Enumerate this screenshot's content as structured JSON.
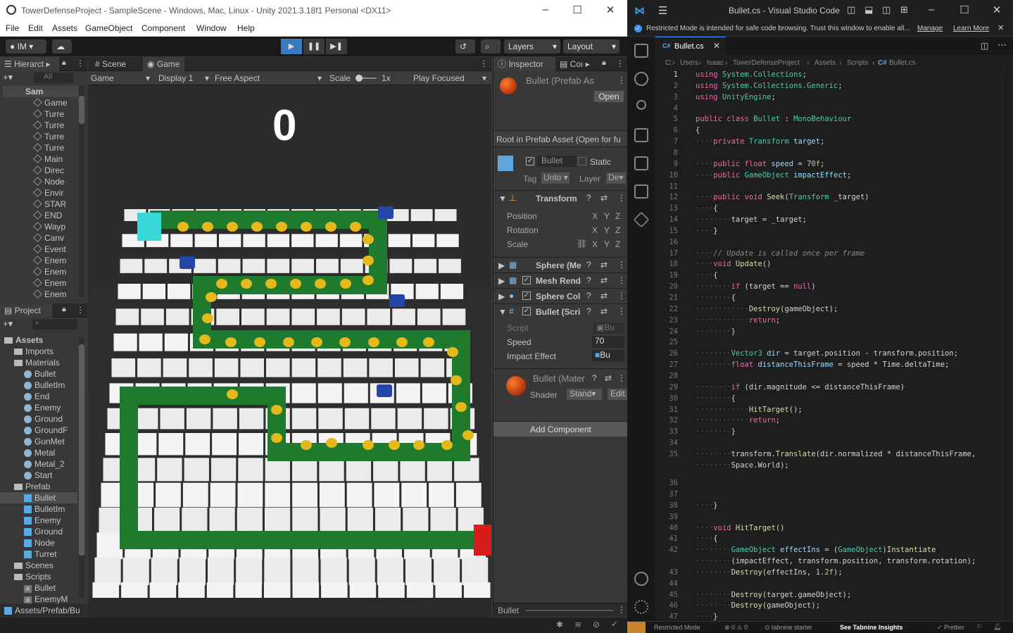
{
  "unity": {
    "title": "TowerDefenseProject - SampleScene - Windows, Mac, Linux - Unity 2021.3.18f1 Personal <DX11>",
    "menu": [
      "File",
      "Edit",
      "Assets",
      "GameObject",
      "Component",
      "Window",
      "Help"
    ],
    "toolbar": {
      "account": "IM",
      "layers": "Layers",
      "layout": "Layout"
    },
    "hierarchy": {
      "tab": "Hierarct",
      "search_placeholder": "All",
      "scene": "Sam",
      "items": [
        "Game",
        "Turre",
        "Turre",
        "Turre",
        "Turre",
        "Main",
        "Direc",
        "Node",
        "Envir",
        "STAR",
        "END",
        "Wayp",
        "Canv",
        "Event",
        "Enem",
        "Enem",
        "Enem",
        "Enem"
      ]
    },
    "game_view": {
      "tab_scene": "Scene",
      "tab_game": "Game",
      "mode": "Game",
      "display": "Display 1",
      "aspect": "Free Aspect",
      "scale_label": "Scale",
      "scale_value": "1x",
      "play_focused": "Play Focused",
      "countdown": "0"
    },
    "inspector": {
      "tab": "Inspector",
      "tab2": "Coı",
      "asset_title": "Bullet (Prefab As",
      "open_button": "Open",
      "root_note": "Root in Prefab Asset (Open for fu",
      "name": "Bullet",
      "static": "Static",
      "tag_label": "Tag",
      "tag_value": "Untɑ",
      "layer_label": "Layer",
      "layer_value": "De",
      "transform": "Transform",
      "position": "Position",
      "rotation": "Rotation",
      "scale": "Scale",
      "components": [
        "Sphere (Me",
        "Mesh Rend",
        "Sphere Col",
        "Bullet (Scri"
      ],
      "script_label": "Script",
      "script_value": "Bu",
      "speed_label": "Speed",
      "speed_value": "70",
      "impact_label": "Impact Effect",
      "impact_value": "Bu",
      "material": "Bullet (Mater",
      "shader_label": "Shader",
      "shader_value": "Stand",
      "edit": "Edit.",
      "add_component": "Add Component",
      "footer": "Bullet"
    },
    "project": {
      "tab": "Project",
      "tree": [
        {
          "label": "Assets",
          "depth": 0,
          "kind": "folder",
          "bold": true
        },
        {
          "label": "Imports",
          "depth": 1,
          "kind": "folder"
        },
        {
          "label": "Materials",
          "depth": 1,
          "kind": "folder"
        },
        {
          "label": "Bullet",
          "depth": 2,
          "kind": "ball"
        },
        {
          "label": "BulletIm",
          "depth": 2,
          "kind": "ball"
        },
        {
          "label": "End",
          "depth": 2,
          "kind": "ball"
        },
        {
          "label": "Enemy",
          "depth": 2,
          "kind": "ball"
        },
        {
          "label": "Ground",
          "depth": 2,
          "kind": "ball"
        },
        {
          "label": "GroundF",
          "depth": 2,
          "kind": "ball"
        },
        {
          "label": "GunMet",
          "depth": 2,
          "kind": "ball"
        },
        {
          "label": "Metal",
          "depth": 2,
          "kind": "ball"
        },
        {
          "label": "Metal_2",
          "depth": 2,
          "kind": "ball"
        },
        {
          "label": "Start",
          "depth": 2,
          "kind": "ball"
        },
        {
          "label": "Prefab",
          "depth": 1,
          "kind": "folder"
        },
        {
          "label": "Bullet",
          "depth": 2,
          "kind": "pcube",
          "selected": true
        },
        {
          "label": "BulletIm",
          "depth": 2,
          "kind": "pcube"
        },
        {
          "label": "Enemy",
          "depth": 2,
          "kind": "pcube"
        },
        {
          "label": "Ground",
          "depth": 2,
          "kind": "pcube"
        },
        {
          "label": "Node",
          "depth": 2,
          "kind": "pcube"
        },
        {
          "label": "Turret",
          "depth": 2,
          "kind": "pcube"
        },
        {
          "label": "Scenes",
          "depth": 1,
          "kind": "folder"
        },
        {
          "label": "Scripts",
          "depth": 1,
          "kind": "folder"
        },
        {
          "label": "Bullet",
          "depth": 2,
          "kind": "hash"
        },
        {
          "label": "EnemyM",
          "depth": 2,
          "kind": "hash"
        }
      ],
      "path": "Assets/Prefab/Bu"
    }
  },
  "vscode": {
    "title": "Bullet.cs - Visual Studio Code",
    "banner": "Restricted Mode is intended for safe code browsing. Trust this window to enable all...",
    "manage": "Manage",
    "learn_more": "Learn More",
    "tab": "Bullet.cs",
    "breadcrumb": [
      "C:",
      "Users",
      "Isaac",
      "TowerDefenseProject",
      "Assets",
      "Scripts",
      "Bullet.cs"
    ],
    "status": {
      "mode": "Restricted Mode",
      "problems": "0",
      "warnings": "0",
      "tabnine": "tabnine starter",
      "insights": "See Tabnine Insights",
      "prettier": "Prettier"
    },
    "lines": [
      {
        "n": "1",
        "y": 0,
        "c": "<span class='kw'>using</span> <span class='ty'>System.Collections</span>;"
      },
      {
        "n": "2",
        "y": 1,
        "c": "<span class='kw'>using</span> <span class='ty'>System.Collections.Generic</span>;"
      },
      {
        "n": "3",
        "y": 2,
        "c": "<span class='kw'>using</span> <span class='ty'>UnityEngine</span>;"
      },
      {
        "n": "4",
        "y": 3,
        "c": ""
      },
      {
        "n": "5",
        "y": 4,
        "c": "<span class='kw'>public</span> <span class='kw'>class</span> <span class='ty'>Bullet</span> : <span class='ty'>MonoBehaviour</span>"
      },
      {
        "n": "6",
        "y": 5,
        "c": "{"
      },
      {
        "n": "7",
        "y": 6,
        "c": "<span class='ws'>····</span><span class='kw'>private</span> <span class='ty'>Transform</span> <span class='bl'>target</span>;"
      },
      {
        "n": "8",
        "y": 7,
        "c": ""
      },
      {
        "n": "9",
        "y": 8,
        "c": "<span class='ws'>····</span><span class='kw'>public</span> <span class='kw'>float</span> <span class='bl'>speed</span> = <span class='nm'>70f</span>;"
      },
      {
        "n": "10",
        "y": 9,
        "c": "<span class='ws'>····</span><span class='kw'>public</span> <span class='ty'>GameObject</span> <span class='bl'>impactEffect</span>;"
      },
      {
        "n": "11",
        "y": 10,
        "c": ""
      },
      {
        "n": "12",
        "y": 11,
        "c": "<span class='ws'>····</span><span class='kw'>public</span> <span class='kw'>void</span> <span class='fn'>Seek</span>(<span class='ty'>Transform</span> _target)"
      },
      {
        "n": "13",
        "y": 12,
        "c": "<span class='ws'>····</span>{"
      },
      {
        "n": "14",
        "y": 13,
        "c": "<span class='ws'>········</span>target = _target;"
      },
      {
        "n": "15",
        "y": 14,
        "c": "<span class='ws'>····</span>}"
      },
      {
        "n": "16",
        "y": 15,
        "c": ""
      },
      {
        "n": "17",
        "y": 16,
        "c": "<span class='ws'>····</span><span class='cm'>// Update is called once per frame</span>"
      },
      {
        "n": "18",
        "y": 17,
        "c": "<span class='ws'>····</span><span class='kw'>void</span> <span class='fn'>Update</span>()"
      },
      {
        "n": "19",
        "y": 18,
        "c": "<span class='ws'>····</span>{"
      },
      {
        "n": "20",
        "y": 19,
        "c": "<span class='ws'>········</span><span class='kw'>if</span> (target == <span class='kw'>null</span>)"
      },
      {
        "n": "21",
        "y": 20,
        "c": "<span class='ws'>········</span>{"
      },
      {
        "n": "22",
        "y": 21,
        "c": "<span class='ws'>············</span><span class='fn'>Destroy</span>(gameObject);"
      },
      {
        "n": "23",
        "y": 22,
        "c": "<span class='ws'>············</span><span class='kw'>return</span>;"
      },
      {
        "n": "24",
        "y": 23,
        "c": "<span class='ws'>········</span>}"
      },
      {
        "n": "25",
        "y": 24,
        "c": ""
      },
      {
        "n": "26",
        "y": 25,
        "c": "<span class='ws'>········</span><span class='ty'>Vector3</span> <span class='bl'>dir</span> = target.position - transform.position;"
      },
      {
        "n": "27",
        "y": 26,
        "c": "<span class='ws'>········</span><span class='kw'>float</span> <span class='bl'>distanceThisFrame</span> = speed * Time.deltaTime;"
      },
      {
        "n": "28",
        "y": 27,
        "c": ""
      },
      {
        "n": "29",
        "y": 28,
        "c": "<span class='ws'>········</span><span class='kw'>if</span> (dir.magnitude &lt;= distanceThisFrame)"
      },
      {
        "n": "30",
        "y": 29,
        "c": "<span class='ws'>········</span>{"
      },
      {
        "n": "31",
        "y": 30,
        "c": "<span class='ws'>············</span><span class='fn'>HitTarget</span>();"
      },
      {
        "n": "32",
        "y": 31,
        "c": "<span class='ws'>············</span><span class='kw'>return</span>;"
      },
      {
        "n": "33",
        "y": 32,
        "c": "<span class='ws'>········</span>}"
      },
      {
        "n": "34",
        "y": 33,
        "c": ""
      },
      {
        "n": "35",
        "y": 34,
        "c": "<span class='ws'>········</span>transform.<span class='fn'>Translate</span>(dir.normalized * distanceThisFrame,"
      },
      {
        "n": "",
        "y": 35,
        "c": "<span class='ws'>········</span>Space.World);"
      },
      {
        "n": "36",
        "y": 36.6,
        "c": ""
      },
      {
        "n": "37",
        "y": 37.6,
        "c": ""
      },
      {
        "n": "38",
        "y": 38.6,
        "c": "<span class='ws'>····</span>}"
      },
      {
        "n": "39",
        "y": 39.6,
        "c": ""
      },
      {
        "n": "40",
        "y": 40.6,
        "c": "<span class='ws'>····</span><span class='kw'>void</span> <span class='fn'>HitTarget</span>()"
      },
      {
        "n": "41",
        "y": 41.6,
        "c": "<span class='ws'>····</span>{"
      },
      {
        "n": "42",
        "y": 42.6,
        "c": "<span class='ws'>········</span><span class='ty'>GameObject</span> <span class='bl'>effectIns</span> = (<span class='ty'>GameObject</span>)<span class='fn'>Instantiate</span>"
      },
      {
        "n": "",
        "y": 43.6,
        "c": "<span class='ws'>········</span>(impactEffect, transform.position, transform.rotation);"
      },
      {
        "n": "43",
        "y": 44.6,
        "c": "<span class='ws'>········</span><span class='fn'>Destroy</span>(effectIns, <span class='nm'>1.2f</span>);"
      },
      {
        "n": "44",
        "y": 45.6,
        "c": ""
      },
      {
        "n": "45",
        "y": 46.6,
        "c": "<span class='ws'>········</span><span class='fn'>Destroy</span>(target.gameObject);"
      },
      {
        "n": "46",
        "y": 47.6,
        "c": "<span class='ws'>········</span><span class='fn'>Destroy</span>(gameObject);"
      },
      {
        "n": "47",
        "y": 48.6,
        "c": "<span class='ws'>····</span>}"
      }
    ]
  }
}
